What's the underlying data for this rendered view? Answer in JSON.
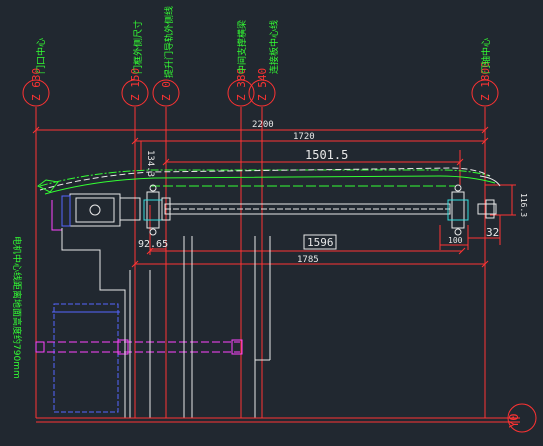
{
  "axes": [
    {
      "id": "a1",
      "code": "Z",
      "value": "630",
      "note": "门口中心"
    },
    {
      "id": "a2",
      "code": "Z",
      "value": "150",
      "note": "门框外侧尺寸"
    },
    {
      "id": "a3",
      "code": "Z",
      "value": "0",
      "note": "提升门导轨外侧线"
    },
    {
      "id": "a4",
      "code": "Z",
      "value": "380",
      "note": "中间支撑横梁"
    },
    {
      "id": "a5",
      "code": "Z",
      "value": "540",
      "note": "连接板中心线"
    },
    {
      "id": "a6",
      "code": "Z",
      "value": "1800",
      "note": "门轴中心"
    }
  ],
  "row_label": "Y0",
  "side_note": "电机中心线距离地面高度约790mm",
  "dims": {
    "d2200": "2200",
    "d1720": "1720",
    "d1501": "1501.5",
    "d1596": "1596",
    "d1785": "1785",
    "d134": "134.3",
    "d9265": "92.65",
    "d100": "100",
    "d32": "32",
    "d1163": "116.3"
  },
  "colors": {
    "background": "#212830",
    "red": "#ff3333",
    "green": "#33ff33",
    "white": "#e8e8e8",
    "magenta": "#ff44ff",
    "blue": "#5566ff",
    "cyan": "#33dddd"
  }
}
